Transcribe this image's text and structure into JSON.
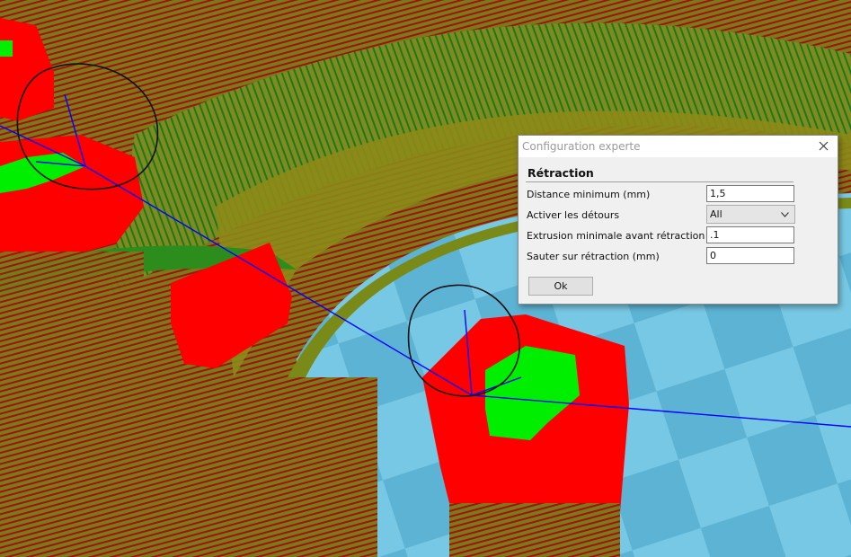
{
  "dialog": {
    "title": "Configuration experte",
    "section_title": "Rétraction",
    "fields": [
      {
        "label": "Distance minimum (mm)",
        "value": "1,5"
      },
      {
        "label": "Activer les détours",
        "value": "All"
      },
      {
        "label": "Extrusion minimale avant rétraction (mm)",
        "value": ".1"
      },
      {
        "label": "Sauter sur rétraction (mm)",
        "value": "0"
      }
    ],
    "ok_label": "Ok"
  },
  "icons": {
    "close": "close-icon",
    "dropdown": "chevron-down-icon"
  },
  "colors": {
    "background_olive": "#6b7a1a",
    "infill_red": "#ff0000",
    "top_layer_green": "#00ee00",
    "build_plate_blue": "#6cc3df",
    "travel_line_blue": "#0000ff"
  }
}
